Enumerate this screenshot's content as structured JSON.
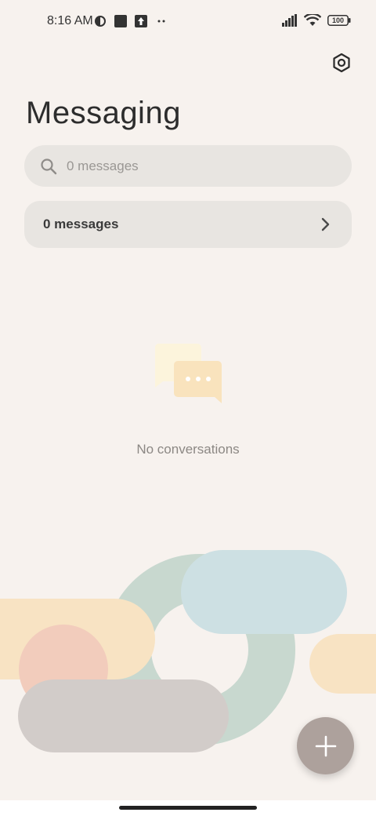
{
  "status_bar": {
    "time": "8:16 AM",
    "battery": "100",
    "left_icons": [
      "vpn-key-icon",
      "square-app-icon",
      "upload-icon",
      "more-dots-icon"
    ],
    "right_icons": [
      "signal-icon",
      "wifi-icon",
      "battery-icon"
    ]
  },
  "header": {
    "title": "Messaging",
    "settings_icon": "settings-hexagon-icon"
  },
  "search": {
    "placeholder": "0 messages"
  },
  "messages_row": {
    "label": "0 messages"
  },
  "empty_state": {
    "text": "No conversations",
    "icon": "chat-bubbles-icon"
  },
  "fab": {
    "icon": "plus-icon"
  },
  "colors": {
    "background": "#f7f2ee",
    "card": "#e8e5e1",
    "fab": "#ada19c",
    "decor_green": "#c8d8cf",
    "decor_blue": "#cde0e3",
    "decor_yellow": "#f8e3c3",
    "decor_peach": "#f2ccbc",
    "decor_gray": "#d2ccc9"
  }
}
